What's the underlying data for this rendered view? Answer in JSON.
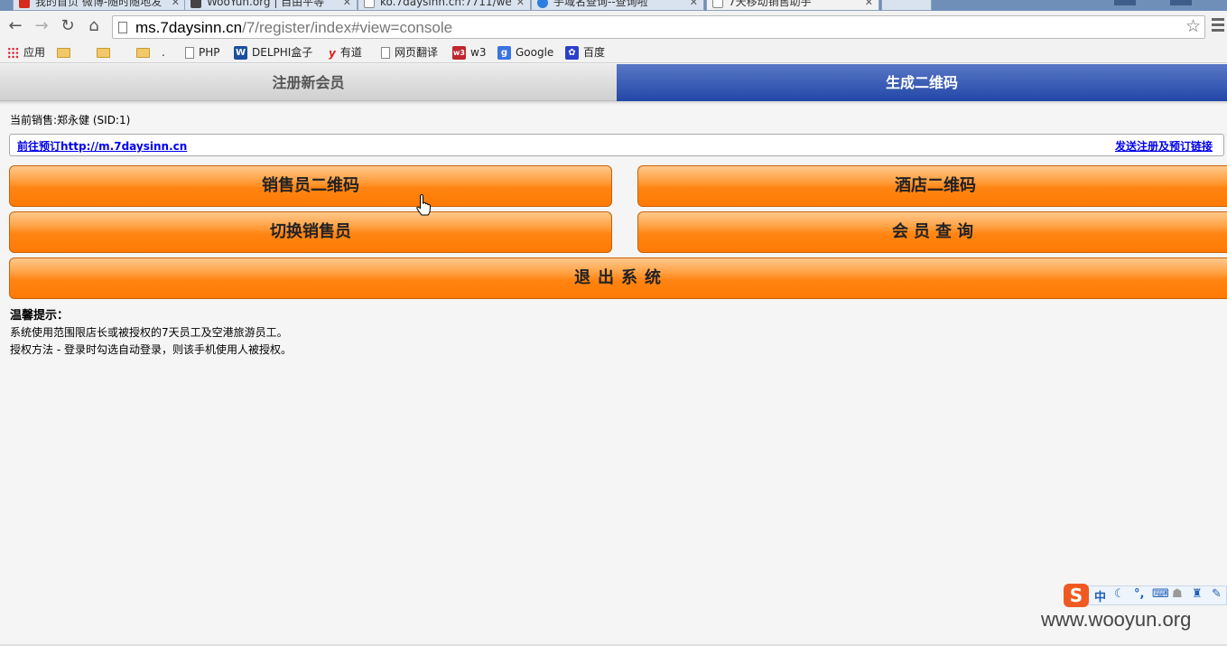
{
  "browser": {
    "tabs": [
      {
        "title": "我的首页 微博-随时随地发",
        "icon_color": "#d52b1e"
      },
      {
        "title": "WooYun.org | 自由平等",
        "icon_color": "#444444"
      },
      {
        "title": "ko.7daysinn.cn:7711/we",
        "icon_color": "#888888"
      },
      {
        "title": "手域名查询--查询啦",
        "icon_color": "#2a7de1"
      },
      {
        "title": "7天移动销售助手",
        "icon_color": "#888888"
      }
    ],
    "url_host": "ms.7daysinn.cn",
    "url_path": "/7/register/index#view=console",
    "bookmarks": [
      {
        "label": "应用",
        "icon": "apps-grid-icon"
      },
      {
        "label": "",
        "icon": "folder-icon"
      },
      {
        "label": "",
        "icon": "folder-icon"
      },
      {
        "label": ".",
        "icon": "folder-icon"
      },
      {
        "label": "PHP",
        "icon": "page-icon"
      },
      {
        "label": "DELPHI盒子",
        "icon": "delphi-w-icon"
      },
      {
        "label": "有道",
        "icon": "youdao-icon"
      },
      {
        "label": "网页翻译",
        "icon": "page-icon"
      },
      {
        "label": "w3",
        "icon": "w3-icon"
      },
      {
        "label": "Google",
        "icon": "google-icon"
      },
      {
        "label": "百度",
        "icon": "baidu-paw-icon"
      }
    ]
  },
  "nav": {
    "register_tab": "注册新会员",
    "qr_tab": "生成二维码"
  },
  "current_sales": "当前销售:郑永健 (SID:1)",
  "links": {
    "booking": "前往预订http://m.7daysinn.cn",
    "send": "发送注册及预订链接"
  },
  "buttons": {
    "seller_qr": "销售员二维码",
    "hotel_qr": "酒店二维码",
    "switch_seller": "切换销售员",
    "member_query": "会员查询",
    "logout": "退出系统"
  },
  "tips": {
    "title": "温馨提示：",
    "line1": "系统使用范围限店长或被授权的7天员工及空港旅游员工。",
    "line2": "授权方法 - 登录时勾选自动登录，则该手机使用人被授权。"
  },
  "ime": {
    "lang": "中"
  },
  "watermark": "www.wooyun.org",
  "colors": {
    "active_tab": "#2347a8",
    "button_orange": "#ff8412",
    "link": "#0000ee"
  }
}
